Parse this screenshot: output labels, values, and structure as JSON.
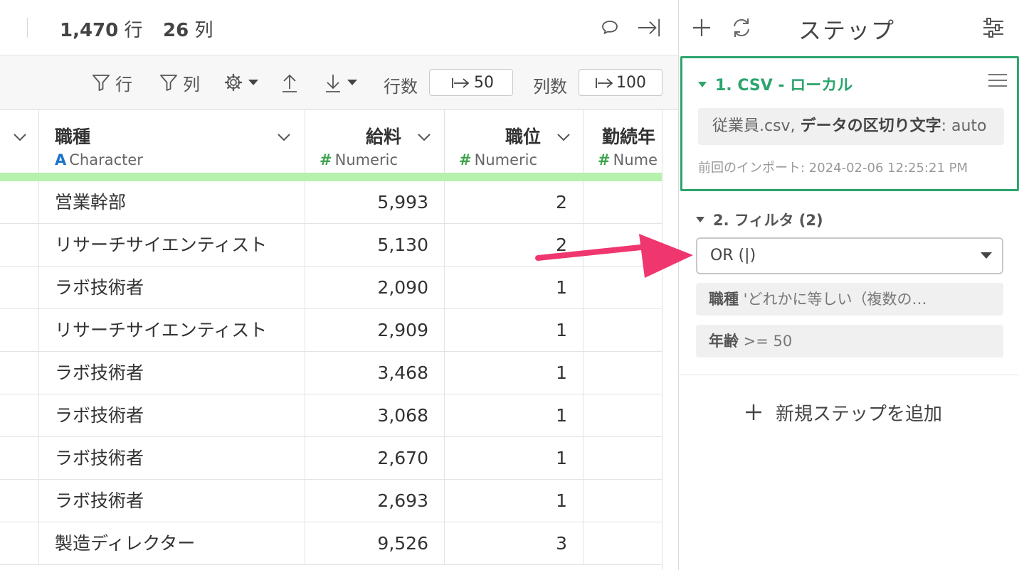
{
  "header": {
    "rows_value": "1,470",
    "rows_unit": "行",
    "cols_value": "26",
    "cols_unit": "列",
    "icons": [
      "comment-icon",
      "collapse-right-icon"
    ]
  },
  "toolbar": {
    "row_filter_label": "行",
    "col_filter_label": "列",
    "rows_label": "行数",
    "rows_value": "50",
    "cols_label": "列数",
    "cols_value": "100",
    "icons": [
      "filter-icon",
      "gear-icon",
      "upload-icon",
      "download-icon",
      "jump-icon"
    ]
  },
  "table": {
    "columns": [
      {
        "name": "職種",
        "type": "Character",
        "type_mark": "A"
      },
      {
        "name": "給料",
        "type": "Numeric",
        "type_mark": "#"
      },
      {
        "name": "職位",
        "type": "Numeric",
        "type_mark": "#"
      },
      {
        "name": "勤続年",
        "type": "Nume",
        "type_mark": "#"
      }
    ],
    "rows": [
      [
        "営業幹部",
        "5,993",
        "2"
      ],
      [
        "リサーチサイエンティスト",
        "5,130",
        "2"
      ],
      [
        "ラボ技術者",
        "2,090",
        "1"
      ],
      [
        "リサーチサイエンティスト",
        "2,909",
        "1"
      ],
      [
        "ラボ技術者",
        "3,468",
        "1"
      ],
      [
        "ラボ技術者",
        "3,068",
        "1"
      ],
      [
        "ラボ技術者",
        "2,670",
        "1"
      ],
      [
        "ラボ技術者",
        "2,693",
        "1"
      ],
      [
        "製造ディレクター",
        "9,526",
        "3"
      ]
    ]
  },
  "steps_panel": {
    "title": "ステップ",
    "icons": [
      "plus-icon",
      "refresh-icon",
      "sliders-icon"
    ],
    "step1": {
      "title": "1. CSV - ローカル",
      "source_file": "従業員.csv,",
      "delimiter_label": "データの区切り文字",
      "delimiter_value": ": auto",
      "imported": "前回のインポート: 2024-02-06 12:25:21 PM"
    },
    "step2": {
      "title": "2. フィルタ (2)",
      "logic_selected": "OR (|)",
      "conditions": [
        {
          "column": "職種",
          "text": " 'どれかに等しい（複数の…"
        },
        {
          "column": "年齢",
          "text": " >= 50"
        }
      ]
    },
    "add_step_label": "新規ステップを追加"
  },
  "colors": {
    "accent_green": "#2ba56d",
    "header_bar": "#b6f2ad",
    "annotation_arrow": "#f0366f",
    "type_character": "#1a73c8",
    "type_numeric": "#3fa34d"
  }
}
